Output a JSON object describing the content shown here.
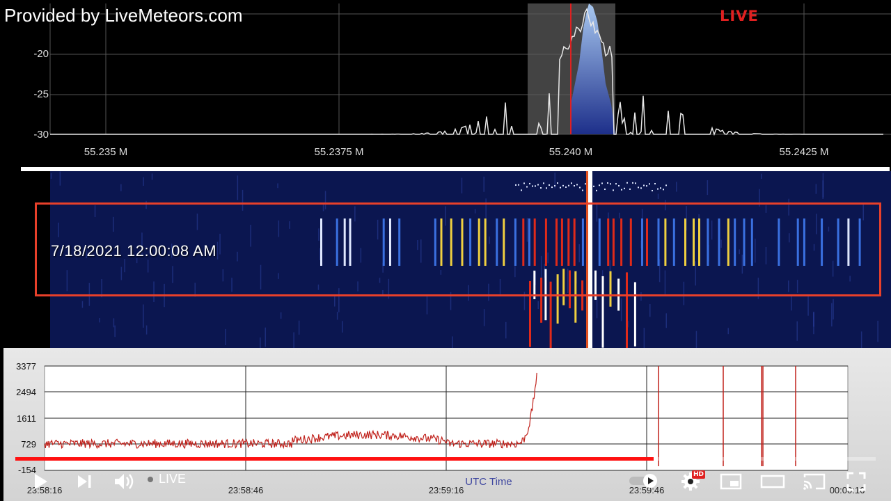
{
  "overlay": {
    "provided_by": "Provided by LiveMeteors.com",
    "live_badge": "LIVE",
    "timestamp": "7/18/2021 12:00:08 AM"
  },
  "spectrum": {
    "db_ticks": [
      "-20",
      "-25",
      "-30"
    ],
    "freq_ticks": [
      "55.235 M",
      "55.2375 M",
      "55.240 M",
      "55.2425 M"
    ]
  },
  "counts_chart": {
    "y_ticks": [
      "3377",
      "2494",
      "1611",
      "729",
      "-154"
    ],
    "x_ticks": [
      "23:58:16",
      "23:58:46",
      "23:59:16",
      "23:59:46",
      "00:00:16"
    ],
    "x_label": "UTC Time"
  },
  "player": {
    "live_label": "LIVE",
    "hd_badge": "HD",
    "progress": 0.742,
    "colors": {
      "progress": "#ff1010",
      "trace": "#c0201a",
      "live_badge": "#e02020"
    }
  },
  "chart_data": {
    "type": "line",
    "x": [
      "23:58:16",
      "23:58:46",
      "23:59:16",
      "23:59:46",
      "00:00:16"
    ],
    "xlabel": "UTC Time",
    "ylabel": "",
    "ylim": [
      -154,
      3377
    ],
    "y_ticks": [
      3377,
      2494,
      1611,
      729,
      -154
    ],
    "grid": true,
    "series": [
      {
        "values_at_time": [
          [
            "23:58:16",
            750
          ],
          [
            "23:58:26",
            720
          ],
          [
            "23:58:36",
            700
          ],
          [
            "23:58:46",
            760
          ],
          [
            "23:58:56",
            850
          ],
          [
            "23:59:01",
            1000
          ],
          [
            "23:59:06",
            900
          ],
          [
            "23:59:16",
            760
          ],
          [
            "23:59:21",
            770
          ],
          [
            "23:59:26",
            950
          ],
          [
            "23:59:29",
            1800
          ],
          [
            "23:59:30",
            3377
          ]
        ]
      }
    ]
  }
}
